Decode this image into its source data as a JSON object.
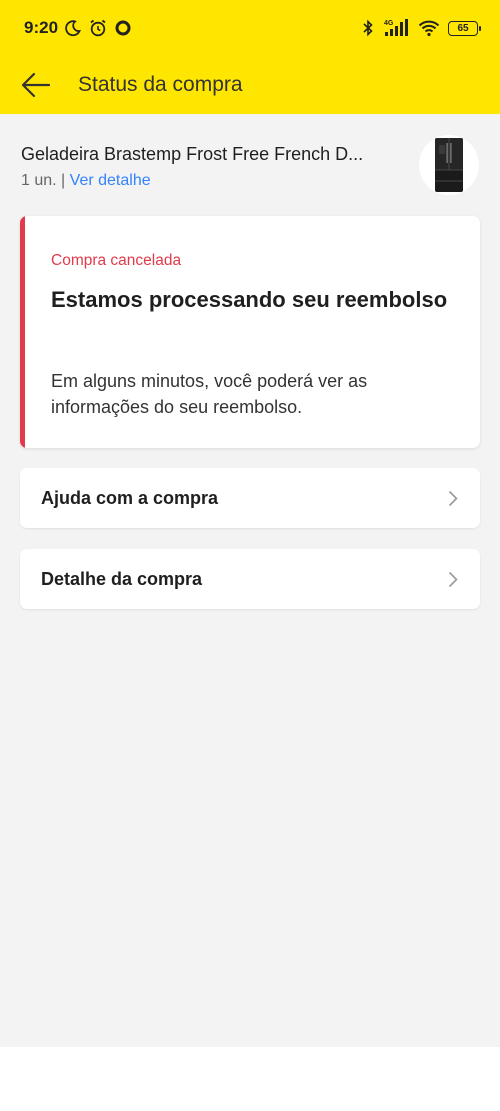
{
  "status_bar": {
    "time": "9:20",
    "network": "4G",
    "battery": "65"
  },
  "header": {
    "title": "Status da compra",
    "back_icon": "arrow-left-icon"
  },
  "product": {
    "name": "Geladeira Brastemp Frost Free French D...",
    "quantity": "1 un.",
    "separator": "|",
    "details_link": "Ver detalhe",
    "thumbnail_icon": "refrigerator-image"
  },
  "status_card": {
    "label": "Compra cancelada",
    "title": "Estamos processando seu reembolso",
    "description": "Em alguns minutos, você poderá ver as informações do seu reembolso.",
    "accent_color": "#e13a4b"
  },
  "actions": [
    {
      "label": "Ajuda com a compra",
      "icon": "chevron-right-icon"
    },
    {
      "label": "Detalhe da compra",
      "icon": "chevron-right-icon"
    }
  ],
  "colors": {
    "header_bg": "#ffe600",
    "link": "#3483fa",
    "page_bg": "#f3f3f3"
  }
}
